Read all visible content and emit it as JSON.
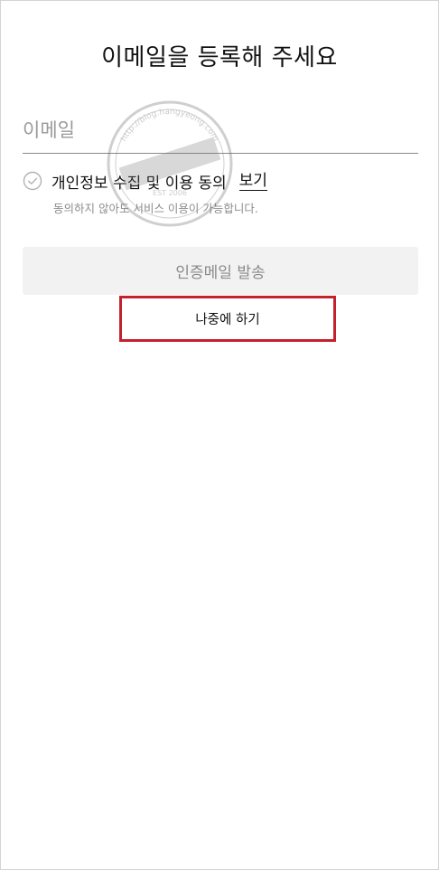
{
  "page": {
    "title": "이메일을 등록해 주세요"
  },
  "email": {
    "placeholder": "이메일",
    "value": ""
  },
  "consent": {
    "label": "개인정보 수집 및 이용 동의",
    "link": "보기",
    "hint": "동의하지 않아도 서비스 이용이 가능합니다."
  },
  "actions": {
    "send_label": "인증메일 발송",
    "later_label": "나중에 하기"
  },
  "watermark": {
    "text": "http://blog.hangyeong.com",
    "year": "EST 2006"
  },
  "colors": {
    "highlight": "#c4212f",
    "disabled_text": "#8a8a8a",
    "button_bg": "#f2f2f2",
    "hint": "#8c8c8c"
  },
  "icons": {
    "consent_check": "check-circle-icon"
  }
}
